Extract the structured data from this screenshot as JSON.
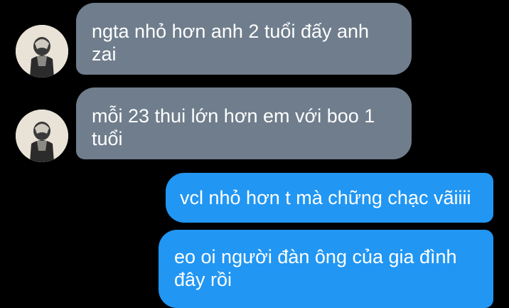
{
  "conversation": {
    "messages": [
      {
        "sender": "contact",
        "text": "ngta nhỏ hơn anh 2 tuổi đấy anh zai"
      },
      {
        "sender": "contact",
        "text": "mỗi 23 thui lớn hơn em với boo 1 tuổi"
      },
      {
        "sender": "me",
        "text": "vcl nhỏ hơn t mà chững chạc vãiiii"
      },
      {
        "sender": "me",
        "text": "eo oi người đàn ông của gia đình đây rồi"
      }
    ]
  },
  "colors": {
    "background": "#000000",
    "incoming_bubble": "#6f7d8c",
    "outgoing_bubble": "#2196f3",
    "text": "#ffffff"
  },
  "icons": {
    "avatar": "contact-avatar-photo"
  }
}
